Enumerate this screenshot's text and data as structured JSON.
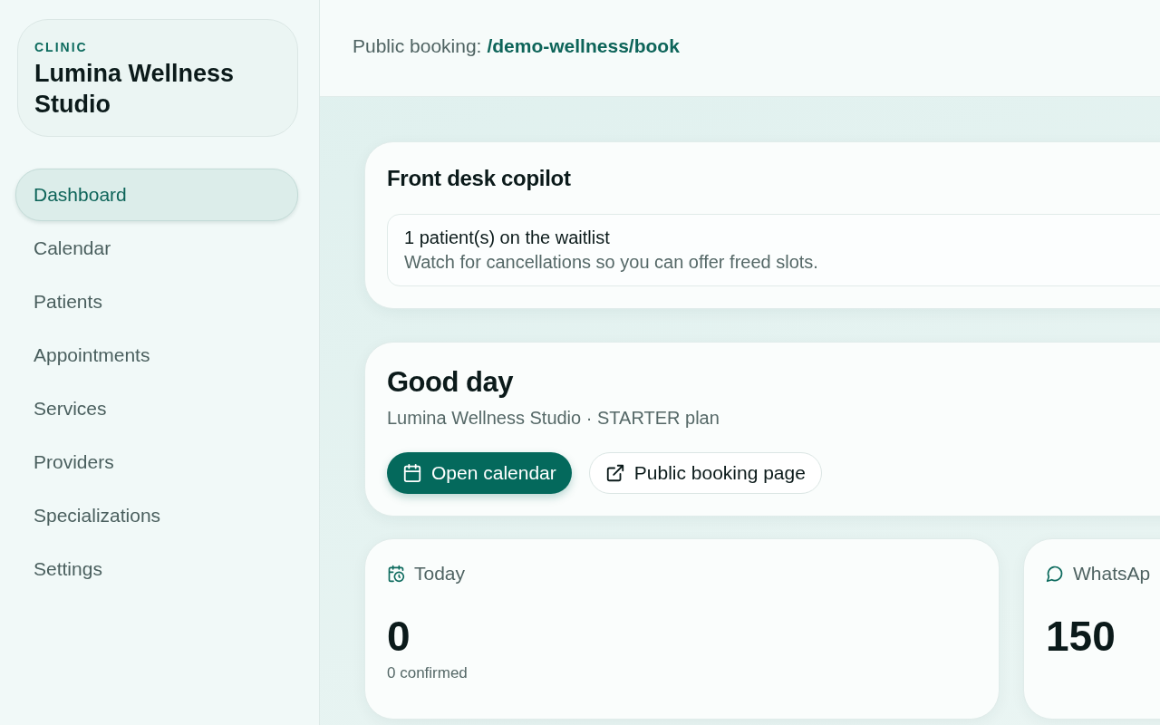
{
  "sidebar": {
    "clinic_label": "CLINIC",
    "clinic_name": "Lumina Wellness Studio",
    "items": [
      {
        "label": "Dashboard",
        "selected": true
      },
      {
        "label": "Calendar",
        "selected": false
      },
      {
        "label": "Patients",
        "selected": false
      },
      {
        "label": "Appointments",
        "selected": false
      },
      {
        "label": "Services",
        "selected": false
      },
      {
        "label": "Providers",
        "selected": false
      },
      {
        "label": "Specializations",
        "selected": false
      },
      {
        "label": "Settings",
        "selected": false
      }
    ]
  },
  "topbar": {
    "label": "Public booking:",
    "link": "/demo-wellness/book"
  },
  "copilot": {
    "title": "Front desk copilot",
    "notice_title": "1 patient(s) on the waitlist",
    "notice_text": "Watch for cancellations so you can offer freed slots."
  },
  "greeting": {
    "title": "Good day",
    "subtitle": "Lumina Wellness Studio · STARTER plan",
    "buttons": [
      {
        "label": "Open calendar",
        "kind": "primary"
      },
      {
        "label": "Public booking page",
        "kind": "secondary"
      }
    ]
  },
  "stats": [
    {
      "kind": "today",
      "label": "Today",
      "value": "0",
      "note": "0 confirmed"
    },
    {
      "kind": "whatsapp",
      "label": "WhatsAp",
      "value": "150"
    }
  ]
}
